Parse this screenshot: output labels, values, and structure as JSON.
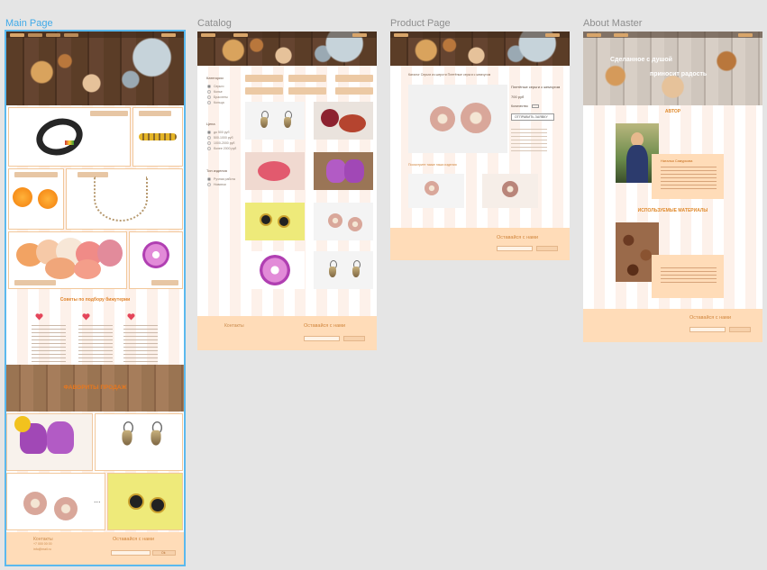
{
  "artboards": {
    "main": {
      "label": "Main Page"
    },
    "catalog": {
      "label": "Catalog"
    },
    "product": {
      "label": "Product Page"
    },
    "about": {
      "label": "About Master"
    }
  },
  "main_page": {
    "tips_title": "Советы по подбору бижутерии",
    "favorites_title": "ФАВОРИТЫ ПРОДАЖ",
    "more_glyph": "...",
    "footer": {
      "contacts_label": "Контакты",
      "contact_lines": [
        "+7 000 00 00",
        "info@mail.ru"
      ],
      "subscribe_title": "Оставайся с нами",
      "subscribe_button": "Ok"
    }
  },
  "catalog_page": {
    "filters": {
      "categories_title": "Категории",
      "category_items": [
        "Серьги",
        "Колье",
        "Браслеты",
        "Кольца"
      ],
      "price_title": "Цена",
      "price_items": [
        "до 500 руб",
        "500-1000 руб",
        "1000-2000 руб",
        "более 2000 руб"
      ],
      "new_title": "Тип изделия",
      "new_items": [
        "Ручная работа",
        "Новинки"
      ]
    },
    "footer": {
      "contacts_label": "Контакты",
      "subscribe_title": "Оставайся с нами"
    }
  },
  "product_page": {
    "breadcrumb": "Каталог Серьги из шерсти Плетёные серьги с жемчугом",
    "product_name": "Плетёные серьги с жемчугом",
    "price": "700 руб",
    "qty_label": "Количество",
    "order_button": "ОТПРАВИТЬ ЗАЯВКУ",
    "related_title": "Посмотрите также наши изделия",
    "footer": {
      "subscribe_title": "Оставайся с нами"
    }
  },
  "about_page": {
    "hero_line1": "Сделанное с душой",
    "hero_line2": "приносит радость",
    "author_title": "АВТОР",
    "author_name": "Наталья Самуркова",
    "materials_title": "ИСПОЛЬЗУЕМЫЕ МАТЕРИАЛЫ",
    "footer": {
      "subscribe_title": "Оставайся с нами"
    }
  }
}
